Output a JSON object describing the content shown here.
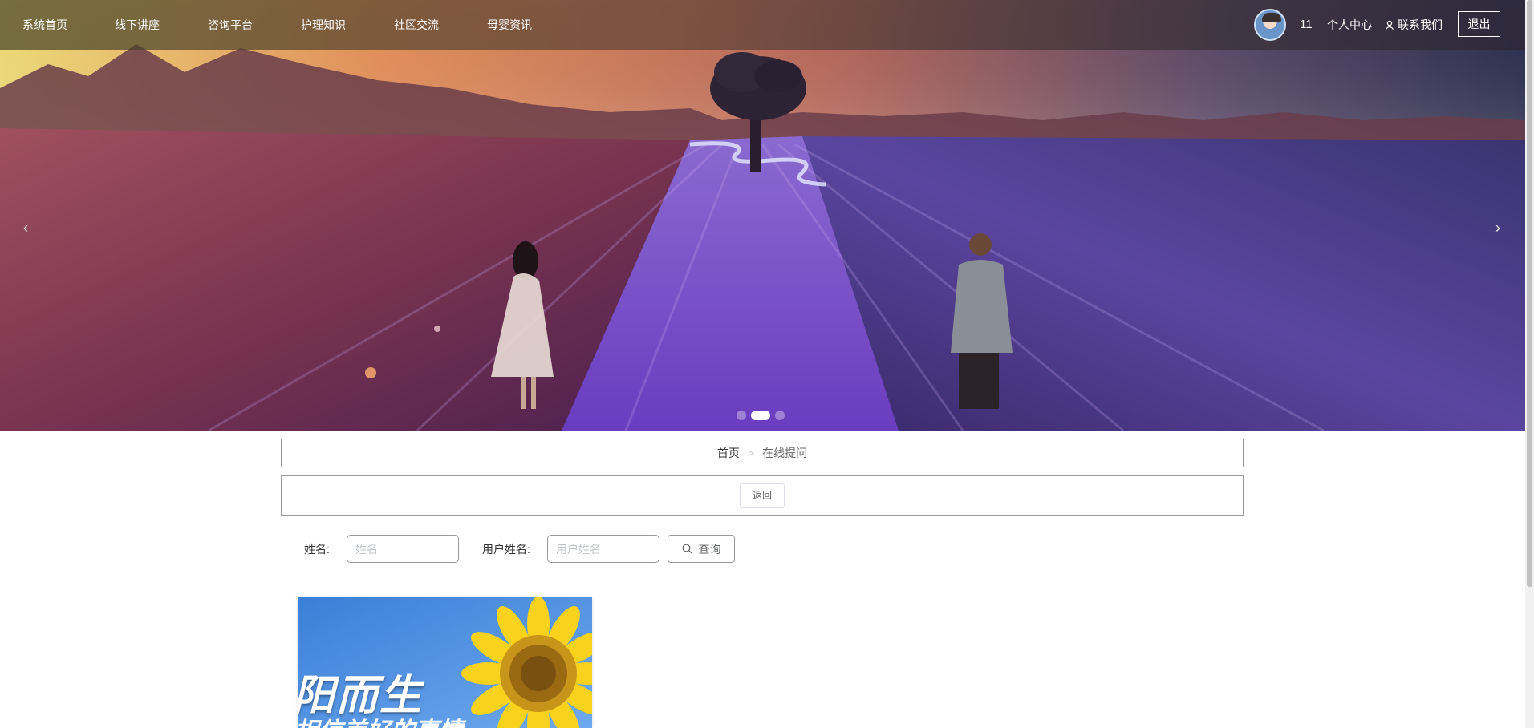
{
  "nav": {
    "items": [
      "系统首页",
      "线下讲座",
      "咨询平台",
      "护理知识",
      "社区交流",
      "母婴资讯"
    ]
  },
  "user": {
    "name": "11",
    "center_label": "个人中心",
    "contact_label": "联系我们",
    "logout_label": "退出"
  },
  "banner": {
    "prev_arrow": "‹",
    "next_arrow": "›",
    "slide_count": 3,
    "active_slide": 2
  },
  "breadcrumb": {
    "home": "首页",
    "separator": ">",
    "current": "在线提问"
  },
  "back_label": "返回",
  "search": {
    "name_label": "姓名:",
    "name_placeholder": "姓名",
    "username_label": "用户姓名:",
    "username_placeholder": "用户姓名",
    "button_label": "查询"
  },
  "cards": [
    {
      "title_text": "阳而生",
      "subtitle_text": "相信美好的事情"
    }
  ],
  "colors": {
    "nav_bar": "#4a4238",
    "border": "#999999",
    "lavender": "#7a4fc4",
    "sky_sunset": "#f6c060"
  }
}
